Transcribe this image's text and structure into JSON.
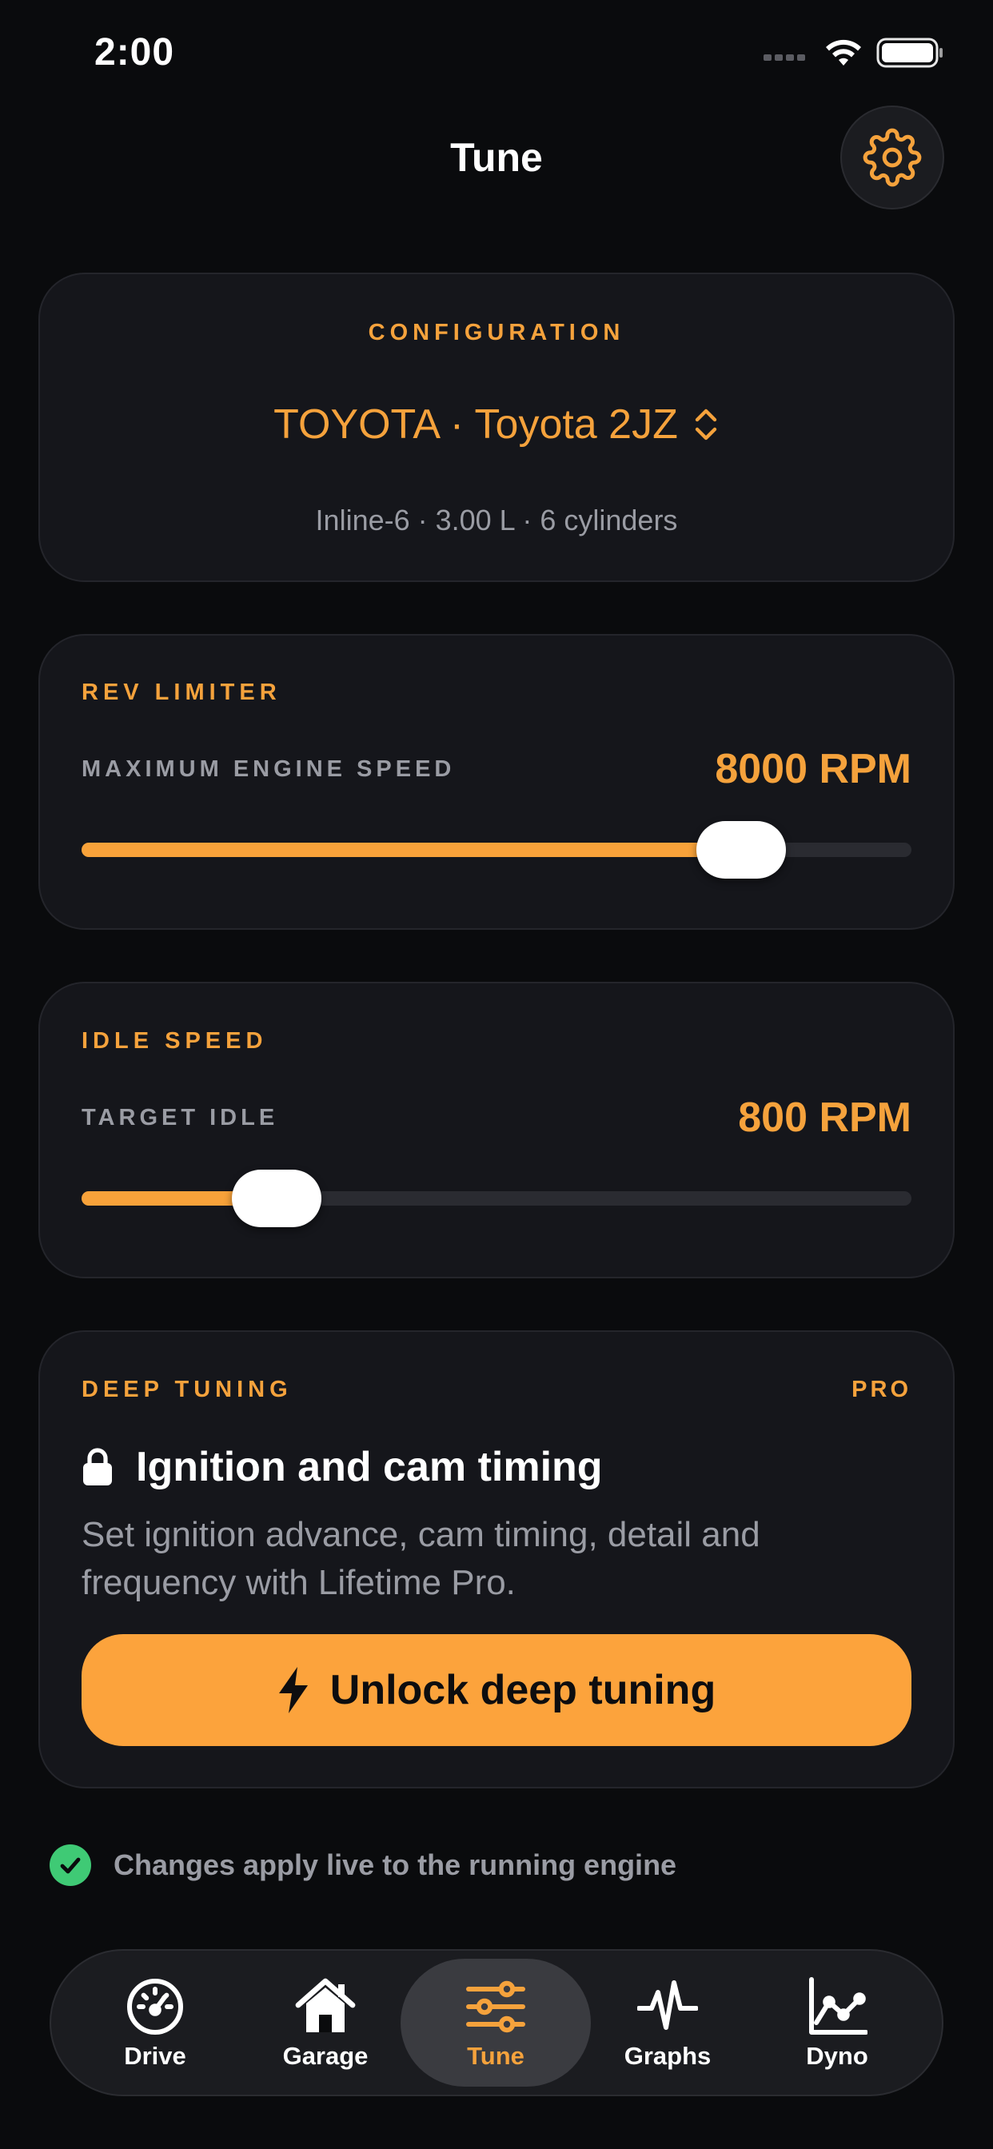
{
  "status_bar": {
    "time": "2:00"
  },
  "header": {
    "title": "Tune"
  },
  "configuration": {
    "label": "CONFIGURATION",
    "model": "TOYOTA · Toyota 2JZ",
    "specs": "Inline-6 · 3.00 L · 6 cylinders"
  },
  "rev_limiter": {
    "label": "REV LIMITER",
    "sub_label": "MAXIMUM ENGINE SPEED",
    "value": "8000 RPM",
    "slider_fraction": 0.795
  },
  "idle_speed": {
    "label": "IDLE SPEED",
    "sub_label": "TARGET IDLE",
    "value": "800 RPM",
    "slider_fraction": 0.235
  },
  "deep_tuning": {
    "label": "DEEP TUNING",
    "badge": "PRO",
    "title": "Ignition and cam timing",
    "description": "Set ignition advance, cam timing, detail and frequency with Lifetime Pro.",
    "button_label": "Unlock deep tuning"
  },
  "live_note": "Changes apply live to the running engine",
  "tabs": [
    {
      "label": "Drive",
      "icon": "gauge-icon"
    },
    {
      "label": "Garage",
      "icon": "house-icon"
    },
    {
      "label": "Tune",
      "icon": "sliders-icon",
      "active": true
    },
    {
      "label": "Graphs",
      "icon": "pulse-icon"
    },
    {
      "label": "Dyno",
      "icon": "line-chart-icon"
    }
  ],
  "colors": {
    "accent": "#f5a23c",
    "background": "#0a0b0d",
    "card": "#15161b",
    "success": "#3fca75"
  }
}
